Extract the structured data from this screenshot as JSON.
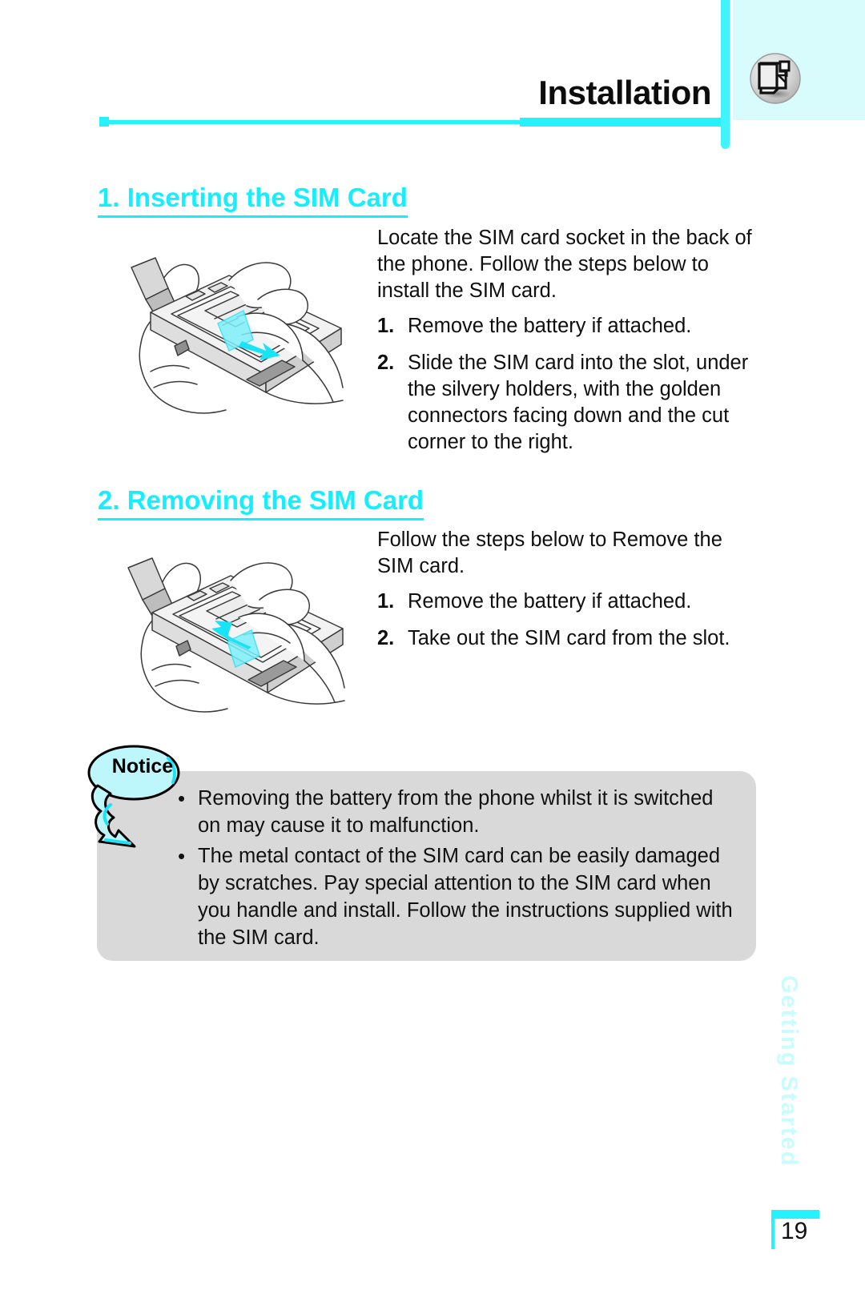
{
  "header": {
    "title": "Installation",
    "icon": "document-page-icon"
  },
  "sections": [
    {
      "heading": "1. Inserting the SIM Card",
      "intro": "Locate the SIM card socket in the back of the phone. Follow the steps below to install the SIM card.",
      "illustration": "hand-inserting-sim-card-into-phone-illustration",
      "steps": [
        {
          "num": "1.",
          "text": "Remove the battery if attached."
        },
        {
          "num": "2.",
          "text": "Slide the SIM card into the slot, under the silvery holders, with the golden connectors facing down and the cut corner to the right."
        }
      ]
    },
    {
      "heading": "2. Removing the SIM Card",
      "intro": "Follow the steps below to Remove the SIM card.",
      "illustration": "hand-removing-sim-card-from-phone-illustration",
      "steps": [
        {
          "num": "1.",
          "text": "Remove the battery if attached."
        },
        {
          "num": "2.",
          "text": "Take out the SIM card from the slot."
        }
      ]
    }
  ],
  "notice": {
    "label": "Notice",
    "bullet": "•",
    "items": [
      "Removing the battery from the phone whilst it is switched on may cause it to malfunction.",
      "The metal contact of the SIM card can be easily damaged by scratches. Pay special attention to the SIM card when you handle and install. Follow the instructions supplied with the SIM card."
    ]
  },
  "side_tab": {
    "label": "Getting Started"
  },
  "footer": {
    "page_number": "19"
  },
  "colors": {
    "accent_cyan": "#25f2fd",
    "heading_cyan": "#14efff",
    "header_tint": "#d8fbfb",
    "notice_gray": "#d9d9d9",
    "side_tab_cyan": "#c9fdfd"
  }
}
